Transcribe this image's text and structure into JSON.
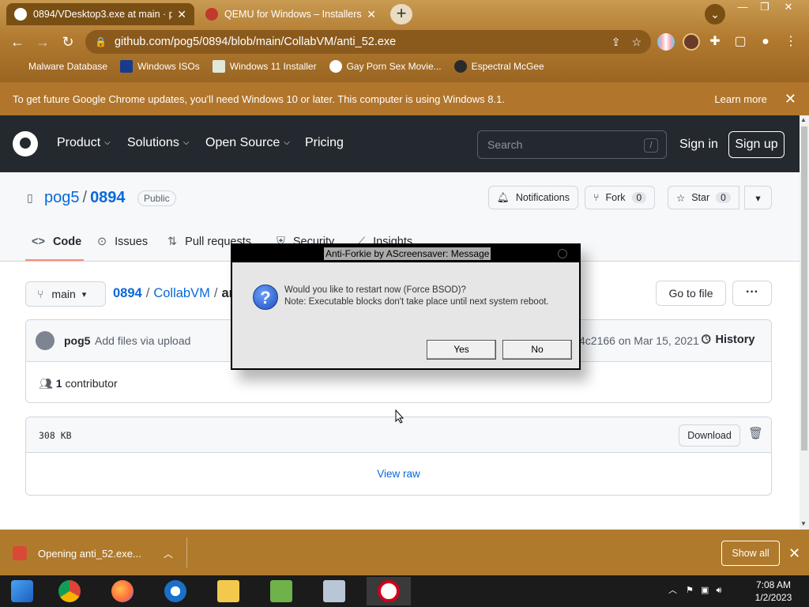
{
  "browser": {
    "tabs": [
      {
        "title": "0894/VDesktop3.exe at main · po",
        "active": true
      },
      {
        "title": "QEMU for Windows – Installers (",
        "active": false
      }
    ],
    "new_tab": "+",
    "url": "github.com/pog5/0894/blob/main/CollabVM/anti_52.exe",
    "bookmarks": [
      "Malware Database",
      "Windows ISOs",
      "Windows 11 Installer",
      "Gay Porn Sex Movie...",
      "Espectral McGee"
    ],
    "infobar": {
      "message": "To get future Google Chrome updates, you'll need Windows 10 or later. This computer is using Windows 8.1.",
      "link": "Learn more"
    },
    "theme_color": "#b07a2c"
  },
  "github": {
    "nav": [
      "Product",
      "Solutions",
      "Open Source",
      "Pricing"
    ],
    "search_placeholder": "Search",
    "search_key": "/",
    "sign_in": "Sign in",
    "sign_up": "Sign up",
    "repo": {
      "owner": "pog5",
      "sep": "/",
      "name": "0894",
      "visibility": "Public",
      "notifications": "Notifications",
      "fork_label": "Fork",
      "fork_count": "0",
      "star_label": "Star",
      "star_count": "0"
    },
    "tabs": [
      "Code",
      "Issues",
      "Pull requests",
      "Security",
      "Insights"
    ],
    "branch": "main",
    "path": {
      "root": "0894",
      "folder": "CollabVM",
      "file_fragment": "an"
    },
    "go_to_file": "Go to file",
    "more": "···",
    "commit": {
      "author": "pog5",
      "message": "Add files via upload",
      "meta": "4c2166 on Mar 15, 2021",
      "history": "History"
    },
    "contributors": {
      "count": "1",
      "label": "contributor"
    },
    "file": {
      "size": "308 KB",
      "download": "Download",
      "view_raw": "View raw"
    }
  },
  "dialog": {
    "title": "Anti-Forkie by AScreensaver: Message",
    "icon": "question-icon",
    "line1": "Would you like to restart now (Force BSOD)?",
    "line2": "Note: Executable blocks don't take place until next system reboot.",
    "yes": "Yes",
    "no": "No"
  },
  "download_shelf": {
    "item": "Opening anti_52.exe...",
    "show_all": "Show all"
  },
  "taskbar": {
    "time": "7:08 AM",
    "date": "1/2/2023"
  }
}
